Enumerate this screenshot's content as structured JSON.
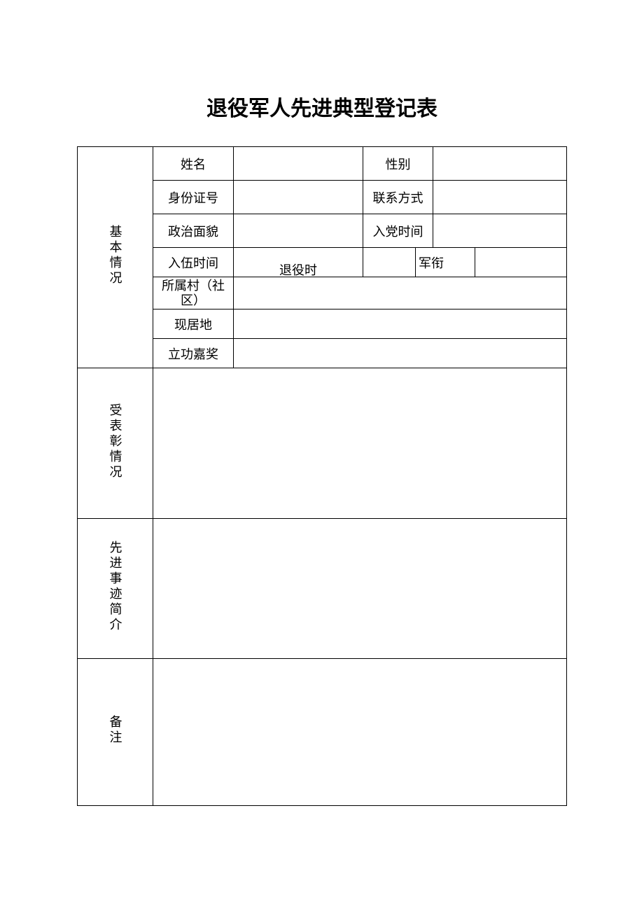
{
  "title": "退役军人先进典型登记表",
  "sections": {
    "basic_info": "基本情况",
    "commendation": "受表彰情况",
    "deeds": "先进事迹简介",
    "remarks": "备注"
  },
  "labels": {
    "name": "姓名",
    "gender": "性别",
    "id_number": "身份证号",
    "contact": "联系方式",
    "political_status": "政治面貌",
    "party_join_date": "入党时间",
    "enlist_date": "入伍时间",
    "discharge_date": "退役时间",
    "rank": "军衔",
    "village": "所属村（社区）",
    "residence": "现居地",
    "merit": "立功嘉奖"
  },
  "values": {
    "name": "",
    "gender": "",
    "id_number": "",
    "contact": "",
    "political_status": "",
    "party_join_date": "",
    "enlist_date": "",
    "discharge_date": "",
    "rank": "",
    "village": "",
    "residence": "",
    "merit": "",
    "commendation": "",
    "deeds": "",
    "remarks": ""
  }
}
